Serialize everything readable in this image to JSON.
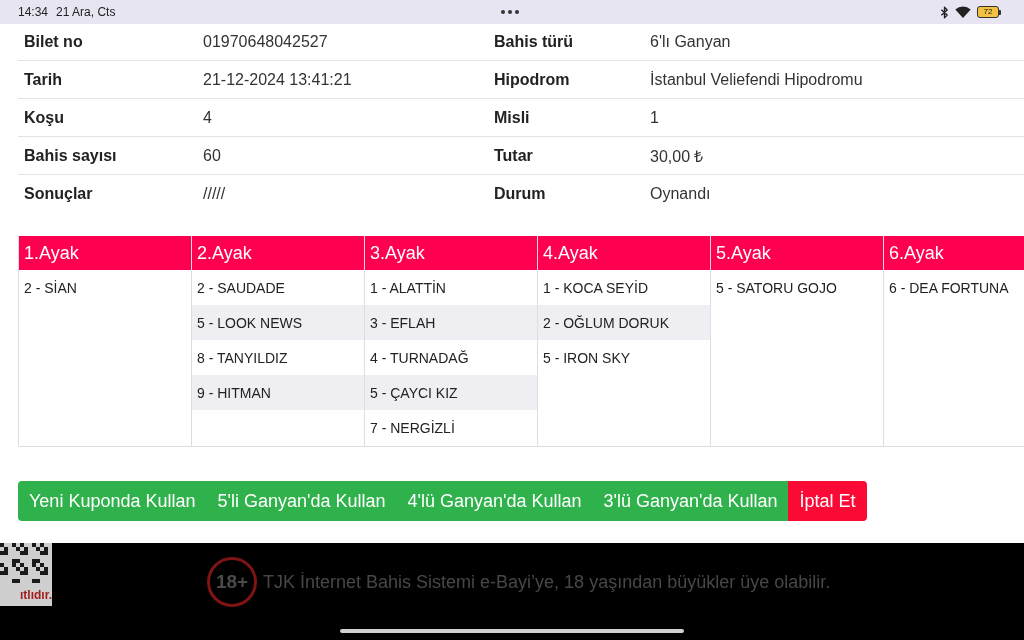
{
  "status_bar": {
    "time": "14:34",
    "date": "21 Ara, Cts",
    "battery": "72"
  },
  "ticket": {
    "rows": [
      {
        "fields": [
          {
            "label": "Bilet no",
            "value": "01970648042527"
          },
          {
            "label": "Bahis türü",
            "value": "6'lı Ganyan"
          }
        ]
      },
      {
        "fields": [
          {
            "label": "Tarih",
            "value": "21-12-2024 13:41:21"
          },
          {
            "label": "Hipodrom",
            "value": "İstanbul Veliefendi Hipodromu"
          }
        ]
      },
      {
        "fields": [
          {
            "label": "Koşu",
            "value": "4"
          },
          {
            "label": "Misli",
            "value": "1"
          }
        ]
      },
      {
        "fields": [
          {
            "label": "Bahis sayısı",
            "value": "60"
          },
          {
            "label": "Tutar",
            "value": "30,00 ₺"
          }
        ]
      },
      {
        "fields": [
          {
            "label": "Sonuçlar",
            "value": "/////"
          },
          {
            "label": "Durum",
            "value": "Oynandı"
          }
        ]
      }
    ]
  },
  "legs": [
    {
      "title": "1.Ayak",
      "horses": [
        "2 - SİAN"
      ]
    },
    {
      "title": "2.Ayak",
      "horses": [
        "2 - SAUDADE",
        "5 - LOOK NEWS",
        "8 - TANYILDIZ",
        "9 - HITMAN"
      ]
    },
    {
      "title": "3.Ayak",
      "horses": [
        "1 - ALATTİN",
        "3 - EFLAH",
        "4 - TURNADAĞ",
        "5 - ÇAYCI KIZ",
        "7 - NERGİZLİ"
      ]
    },
    {
      "title": "4.Ayak",
      "horses": [
        "1 - KOCA SEYİD",
        "2 - OĞLUM DORUK",
        "5 - IRON SKY"
      ]
    },
    {
      "title": "5.Ayak",
      "horses": [
        "5 - SATORU GOJO"
      ]
    },
    {
      "title": "6.Ayak",
      "horses": [
        "6 - DEA FORTUNA"
      ]
    }
  ],
  "actions": [
    {
      "label": "Yeni Kuponda Kullan",
      "kind": "primary"
    },
    {
      "label": "5'li Ganyan'da Kullan",
      "kind": "primary"
    },
    {
      "label": "4'lü Ganyan'da Kullan",
      "kind": "primary"
    },
    {
      "label": "3'lü Ganyan'da Kullan",
      "kind": "primary"
    },
    {
      "label": "İptal Et",
      "kind": "danger"
    }
  ],
  "footer": {
    "qr_caption": "ıtlıdır.",
    "age_badge": "18+",
    "notice": "TJK İnternet Bahis Sistemi e-Bayi’ye, 18 yaşından büyükler üye olabilir."
  }
}
